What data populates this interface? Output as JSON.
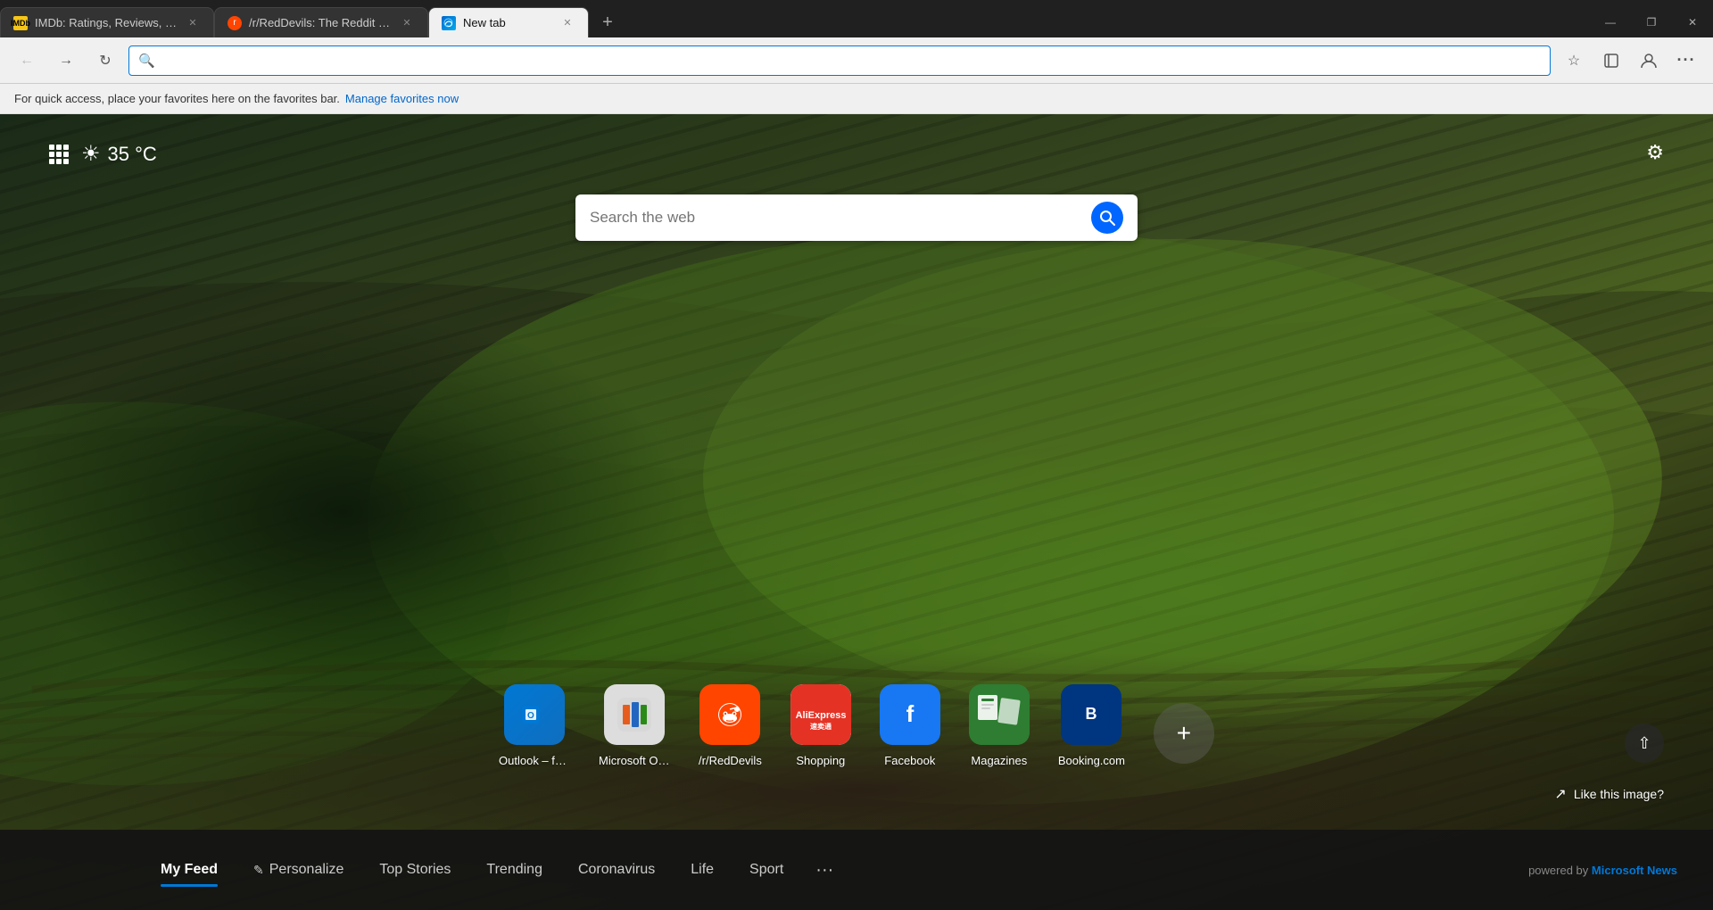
{
  "tabs": [
    {
      "id": "tab-imdb",
      "title": "IMDb: Ratings, Reviews, and Wh...",
      "favicon": "imdb",
      "active": false,
      "closable": true
    },
    {
      "id": "tab-reddit",
      "title": "/r/RedDevils: The Reddit home f...",
      "favicon": "reddit",
      "active": false,
      "closable": true
    },
    {
      "id": "tab-newtab",
      "title": "New tab",
      "favicon": "edge",
      "active": true,
      "closable": true
    }
  ],
  "toolbar": {
    "back_disabled": true,
    "forward_label": "→",
    "refresh_label": "↺",
    "address_placeholder": "",
    "address_value": "",
    "star_label": "☆",
    "collections_label": "⊞",
    "account_label": "👤",
    "more_label": "..."
  },
  "favorites_bar": {
    "message": "For quick access, place your favorites here on the favorites bar.",
    "link_text": "Manage favorites now"
  },
  "newtab": {
    "weather": {
      "temp": "35 °C",
      "icon": "☀"
    },
    "search_placeholder": "Search the web",
    "settings_icon": "⚙",
    "like_image_label": "Like this image?",
    "shortcuts": [
      {
        "id": "outlook",
        "label": "Outlook – fre...",
        "icon_type": "outlook"
      },
      {
        "id": "office",
        "label": "Microsoft Offi...",
        "icon_type": "office"
      },
      {
        "id": "reddit",
        "label": "/r/RedDevils",
        "icon_type": "reddit"
      },
      {
        "id": "shopping",
        "label": "Shopping",
        "icon_type": "aliexpress"
      },
      {
        "id": "facebook",
        "label": "Facebook",
        "icon_type": "facebook"
      },
      {
        "id": "magazines",
        "label": "Magazines",
        "icon_type": "magazines"
      },
      {
        "id": "booking",
        "label": "Booking.com",
        "icon_type": "booking"
      }
    ],
    "news_tabs": [
      {
        "id": "myfeed",
        "label": "My Feed",
        "active": true
      },
      {
        "id": "personalize",
        "label": "Personalize",
        "active": false,
        "icon": "✏"
      },
      {
        "id": "topstories",
        "label": "Top Stories",
        "active": false
      },
      {
        "id": "trending",
        "label": "Trending",
        "active": false
      },
      {
        "id": "coronavirus",
        "label": "Coronavirus",
        "active": false
      },
      {
        "id": "life",
        "label": "Life",
        "active": false
      },
      {
        "id": "sport",
        "label": "Sport",
        "active": false
      }
    ],
    "powered_by": "powered by",
    "powered_by_brand": "Microsoft News"
  },
  "window_controls": {
    "minimize": "—",
    "maximize": "❐",
    "close": "✕"
  }
}
